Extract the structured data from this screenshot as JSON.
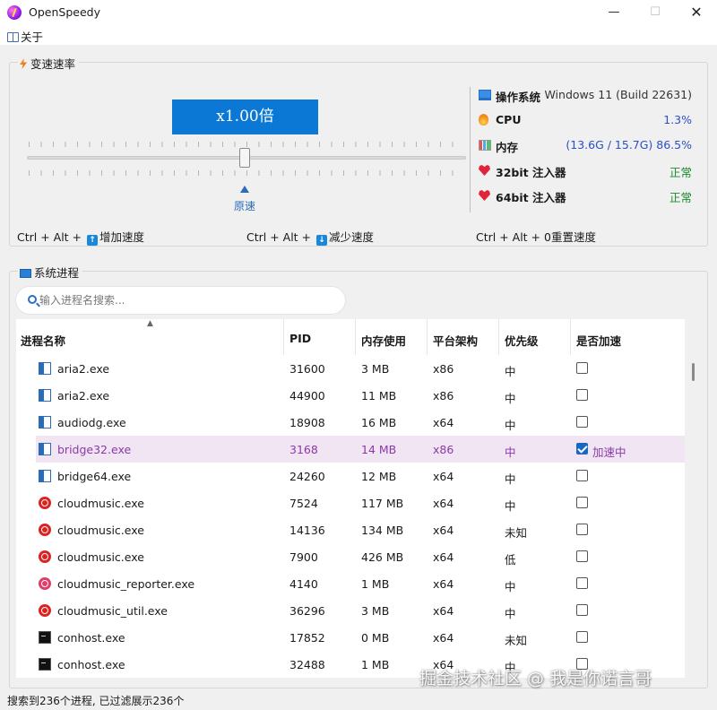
{
  "window": {
    "title": "OpenSpeedy",
    "minimize": "—",
    "maximize": "☐",
    "close": "✕"
  },
  "menu": {
    "about": "关于"
  },
  "speed": {
    "group_title": "变速速率",
    "rate_display": "x1.00倍",
    "original_label": "原速",
    "slider_value": 1.0
  },
  "system": {
    "os_label": "操作系统",
    "os_value": "Windows 11 (Build 22631)",
    "cpu_label": "CPU",
    "cpu_value": "1.3%",
    "mem_label": "内存",
    "mem_value": "(13.6G / 15.7G) 86.5%",
    "inj32_label": "32bit 注入器",
    "inj32_value": "正常",
    "inj64_label": "64bit 注入器",
    "inj64_value": "正常"
  },
  "hotkeys": {
    "inc_prefix": "Ctrl + Alt +",
    "inc_key": "↑",
    "inc_label": "增加速度",
    "dec_prefix": "Ctrl + Alt +",
    "dec_key": "↓",
    "dec_label": "减少速度",
    "reset_prefix": "Ctrl + Alt + 0",
    "reset_label": "重置速度"
  },
  "processes": {
    "group_title": "系统进程",
    "search_placeholder": "输入进程名搜索...",
    "columns": [
      "进程名称",
      "PID",
      "内存使用",
      "平台架构",
      "优先级",
      "是否加速"
    ],
    "rows": [
      {
        "icon": "app-icon",
        "name": "aria2.exe",
        "pid": "31600",
        "mem": "3 MB",
        "arch": "x86",
        "priority": "中",
        "accel": false,
        "accel_label": ""
      },
      {
        "icon": "app-icon",
        "name": "aria2.exe",
        "pid": "44900",
        "mem": "11 MB",
        "arch": "x86",
        "priority": "中",
        "accel": false,
        "accel_label": ""
      },
      {
        "icon": "app-icon",
        "name": "audiodg.exe",
        "pid": "18908",
        "mem": "16 MB",
        "arch": "x64",
        "priority": "中",
        "accel": false,
        "accel_label": ""
      },
      {
        "icon": "app-icon",
        "name": "bridge32.exe",
        "pid": "3168",
        "mem": "14 MB",
        "arch": "x86",
        "priority": "中",
        "accel": true,
        "accel_label": "加速中"
      },
      {
        "icon": "app-icon",
        "name": "bridge64.exe",
        "pid": "24260",
        "mem": "12 MB",
        "arch": "x64",
        "priority": "中",
        "accel": false,
        "accel_label": ""
      },
      {
        "icon": "cloudmusic-icon",
        "name": "cloudmusic.exe",
        "pid": "7524",
        "mem": "117 MB",
        "arch": "x64",
        "priority": "中",
        "accel": false,
        "accel_label": ""
      },
      {
        "icon": "cloudmusic-icon",
        "name": "cloudmusic.exe",
        "pid": "14136",
        "mem": "134 MB",
        "arch": "x64",
        "priority": "未知",
        "accel": false,
        "accel_label": ""
      },
      {
        "icon": "cloudmusic-icon",
        "name": "cloudmusic.exe",
        "pid": "7900",
        "mem": "426 MB",
        "arch": "x64",
        "priority": "低",
        "accel": false,
        "accel_label": ""
      },
      {
        "icon": "cloudmusic-reporter-icon",
        "name": "cloudmusic_reporter.exe",
        "pid": "4140",
        "mem": "1 MB",
        "arch": "x64",
        "priority": "中",
        "accel": false,
        "accel_label": ""
      },
      {
        "icon": "cloudmusic-icon",
        "name": "cloudmusic_util.exe",
        "pid": "36296",
        "mem": "3 MB",
        "arch": "x64",
        "priority": "中",
        "accel": false,
        "accel_label": ""
      },
      {
        "icon": "console-icon",
        "name": "conhost.exe",
        "pid": "17852",
        "mem": "0 MB",
        "arch": "x64",
        "priority": "未知",
        "accel": false,
        "accel_label": ""
      },
      {
        "icon": "console-icon",
        "name": "conhost.exe",
        "pid": "32488",
        "mem": "1 MB",
        "arch": "x64",
        "priority": "中",
        "accel": false,
        "accel_label": ""
      }
    ],
    "selected_row": 3
  },
  "status": {
    "text": "搜索到236个进程, 已过滤展示236个"
  },
  "watermark": {
    "text": "掘金技术社区 @ 我是你诺言哥"
  },
  "colors": {
    "accent": "#0b78d6",
    "selected_row": "#f1e4f3",
    "selected_text": "#8a3aa8",
    "ok_green": "#1b8a2b"
  }
}
